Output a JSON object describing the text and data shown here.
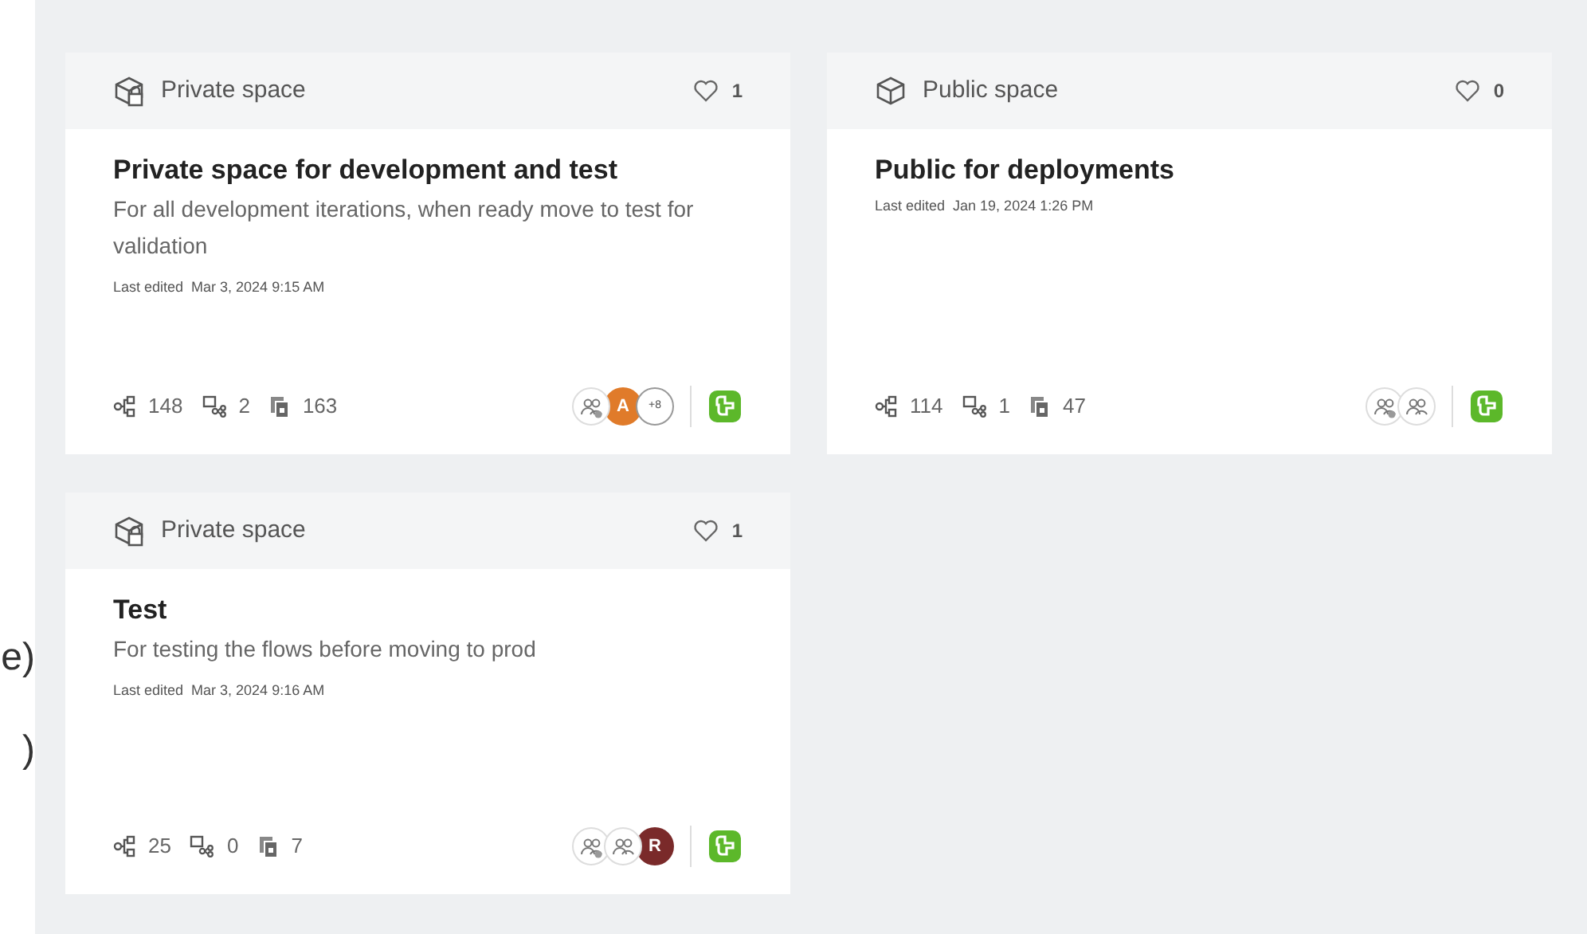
{
  "left_fragments": [
    "e)",
    ")"
  ],
  "cards": [
    {
      "kind": "private",
      "space_label": "Private space",
      "likes": "1",
      "title": "Private space for development and test",
      "description": "For all development iterations, when ready move to test for validation",
      "last_edited_label": "Last edited",
      "last_edited": "Mar 3, 2024 9:15 AM",
      "stats": [
        {
          "kind": "flows",
          "value": "148"
        },
        {
          "kind": "subflows",
          "value": "2"
        },
        {
          "kind": "documents",
          "value": "163"
        }
      ],
      "members": [
        {
          "kind": "admin-group"
        },
        {
          "kind": "letter",
          "text": "A",
          "color": "#e07b2a"
        },
        {
          "kind": "more",
          "text": "+8"
        }
      ]
    },
    {
      "kind": "public",
      "space_label": "Public space",
      "likes": "0",
      "title": "Public for deployments",
      "last_edited_label": "Last edited",
      "last_edited": "Jan 19, 2024 1:26 PM",
      "stats": [
        {
          "kind": "flows",
          "value": "114"
        },
        {
          "kind": "subflows",
          "value": "1"
        },
        {
          "kind": "documents",
          "value": "47"
        }
      ],
      "members": [
        {
          "kind": "admin-group"
        },
        {
          "kind": "group"
        }
      ]
    },
    {
      "kind": "private",
      "space_label": "Private space",
      "likes": "1",
      "title": "Test",
      "description": "For testing the flows before moving to prod",
      "last_edited_label": "Last edited",
      "last_edited": "Mar 3, 2024 9:16 AM",
      "stats": [
        {
          "kind": "flows",
          "value": "25"
        },
        {
          "kind": "subflows",
          "value": "0"
        },
        {
          "kind": "documents",
          "value": "7"
        }
      ],
      "members": [
        {
          "kind": "admin-group"
        },
        {
          "kind": "group"
        },
        {
          "kind": "letter",
          "text": "R",
          "color": "#7a2a2a"
        }
      ]
    }
  ]
}
